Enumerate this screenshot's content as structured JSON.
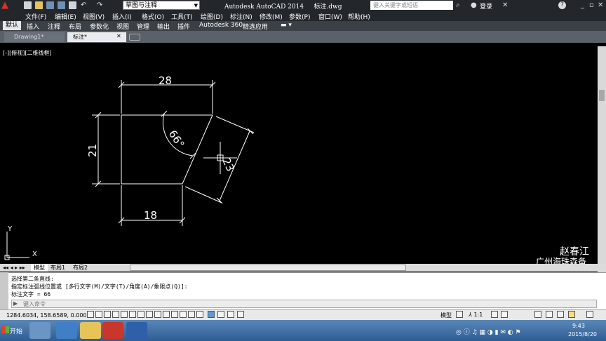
{
  "titlebar": {
    "workspace": "草图与注释",
    "app_title": "Autodesk AutoCAD 2014",
    "file_name": "标注.dwg",
    "search_placeholder": "键入关键字或短语",
    "login": "登录"
  },
  "menubar": {
    "items": [
      "文件(F)",
      "编辑(E)",
      "视图(V)",
      "插入(I)",
      "格式(O)",
      "工具(T)",
      "绘图(D)",
      "标注(N)",
      "修改(M)",
      "参数(P)",
      "窗口(W)",
      "帮助(H)"
    ]
  },
  "ribbon": {
    "tabs": [
      "默认",
      "插入",
      "注释",
      "布局",
      "参数化",
      "视图",
      "管理",
      "输出",
      "插件",
      "Autodesk 360",
      "精选应用"
    ]
  },
  "doc_tabs": {
    "items": [
      "Drawing1*",
      "标注*"
    ]
  },
  "viewport": {
    "label": "[-][俯视][二维线框]"
  },
  "drawing": {
    "dim_top": "28",
    "dim_left": "21",
    "dim_bottom": "18",
    "dim_angle": "66°",
    "dim_slant": "23"
  },
  "ucs": {
    "x": "X",
    "y": "Y"
  },
  "layout_tabs": {
    "items": [
      "模型",
      "布局1",
      "布局2"
    ]
  },
  "command": {
    "lines": [
      "选择第二条直线:",
      "指定标注弧线位置或 [多行文字(M)/文字(T)/角度(A)/象限点(Q)]:",
      "标注文字 = 66"
    ],
    "input_placeholder": "键入命令"
  },
  "status": {
    "coords": "1284.6034, 158.6589, 0.0000",
    "model": "模型",
    "scale": "1:1"
  },
  "watermark": {
    "name": "赵春江",
    "sub": "广州海珠森备"
  },
  "taskbar": {
    "start": "开始",
    "time": "9:43",
    "date": "2015/8/20"
  }
}
